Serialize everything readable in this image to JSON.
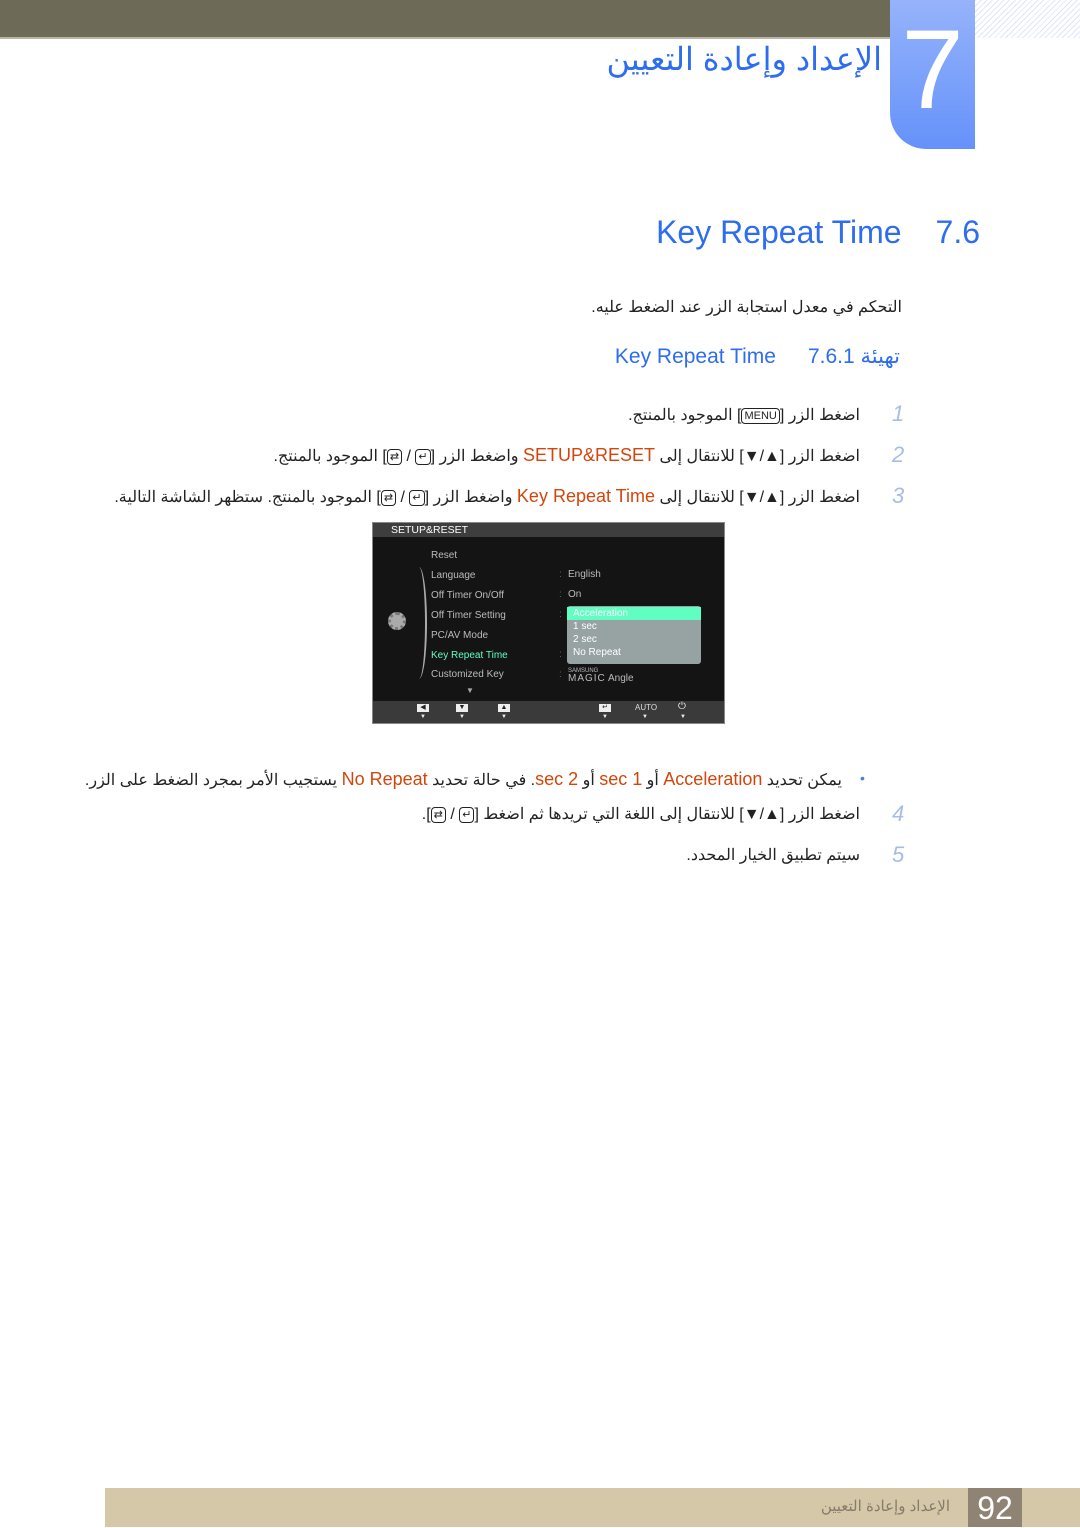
{
  "chapter": {
    "number": "7",
    "title": "الإعداد وإعادة التعيين"
  },
  "section": {
    "number": "7.6",
    "title": "Key Repeat Time"
  },
  "intro": "التحكم في معدل استجابة الزر عند الضغط عليه.",
  "subsection": {
    "number": "7.6.1",
    "title": "تهيئة Key Repeat Time"
  },
  "steps": [
    {
      "num": "1",
      "a": "اضغط الزر ",
      "key": "MENU",
      "b": " الموجود بالمنتج."
    },
    {
      "num": "2",
      "a": "اضغط الزر [▲/▼] للانتقال إلى ",
      "hl": "SETUP&RESET",
      "b": " واضغط الزر ",
      "c": " الموجود بالمنتج."
    },
    {
      "num": "3",
      "a": "اضغط الزر [▲/▼] للانتقال إلى ",
      "hl": "Key Repeat Time",
      "b": " واضغط الزر ",
      "c": " الموجود بالمنتج. ستظهر الشاشة التالية."
    },
    {
      "num": "4",
      "a": "اضغط الزر [▲/▼] للانتقال إلى اللغة التي تريدها ثم اضغط ",
      "c": "."
    },
    {
      "num": "5",
      "a": "سيتم تطبيق الخيار المحدد."
    }
  ],
  "note": {
    "a": "يمكن تحديد ",
    "h1": "Acceleration",
    "b": " أو ",
    "h2": "sec 1",
    "c": " أو ",
    "h3": "sec 2",
    "d": ". في حالة تحديد ",
    "h4": "No Repeat",
    "e": " يستجيب الأمر بمجرد الضغط على الزر."
  },
  "osd": {
    "header": "SETUP&RESET",
    "items": [
      "Reset",
      "Language",
      "Off Timer On/Off",
      "Off Timer Setting",
      "PC/AV Mode",
      "Key Repeat Time",
      "Customized Key"
    ],
    "values": {
      "language": "English",
      "off_timer": "On",
      "customized_small": "SAMSUNG",
      "customized_big": "MAGIC",
      "customized_rest": "Angle"
    },
    "dropdown": [
      "Acceleration",
      "1 sec",
      "2 sec",
      "No Repeat"
    ],
    "footer_auto": "AUTO",
    "highlight_color": "#5effc0"
  },
  "footer": {
    "title": "الإعداد وإعادة التعيين",
    "page": "92"
  }
}
